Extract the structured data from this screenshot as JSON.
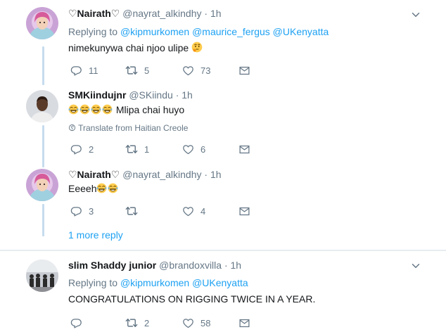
{
  "tweets": [
    {
      "name": "♡Nairath♡",
      "handle": "@nayrat_alkindhy",
      "sep": "·",
      "time": "1h",
      "replying_label": "Replying to",
      "mentions": [
        "@kipmurkomen",
        "@maurice_fergus",
        "@UKenyatta"
      ],
      "text": "nimekunywa chai njoo ulipe",
      "emoji": "thinking-face",
      "replies": "11",
      "retweets": "5",
      "likes": "73"
    },
    {
      "name": "SMKiindujnr",
      "handle": "@SKiindu",
      "sep": "·",
      "time": "1h",
      "text": "Mlipa chai huyo",
      "emoji": "tears-of-joy x4",
      "translate": "Translate from Haitian Creole",
      "replies": "2",
      "retweets": "1",
      "likes": "6"
    },
    {
      "name": "♡Nairath♡",
      "handle": "@nayrat_alkindhy",
      "sep": "·",
      "time": "1h",
      "text": "Eeeeh",
      "emoji": "tears-of-joy x2",
      "replies": "3",
      "retweets": "",
      "likes": "4"
    },
    {
      "name": "slim Shaddy junior",
      "handle": "@brandoxvilla",
      "sep": "·",
      "time": "1h",
      "replying_label": "Replying to",
      "mentions": [
        "@kipmurkomen",
        "@UKenyatta"
      ],
      "text": "CONGRATULATIONS ON RIGGING TWICE IN A YEAR.",
      "replies": "",
      "retweets": "2",
      "likes": "58"
    }
  ],
  "more_reply": "1 more reply",
  "colors": {
    "link": "#1da1f2",
    "secondary": "#657786",
    "thread_line": "#c6dcee",
    "divider": "#e6ecf0"
  }
}
